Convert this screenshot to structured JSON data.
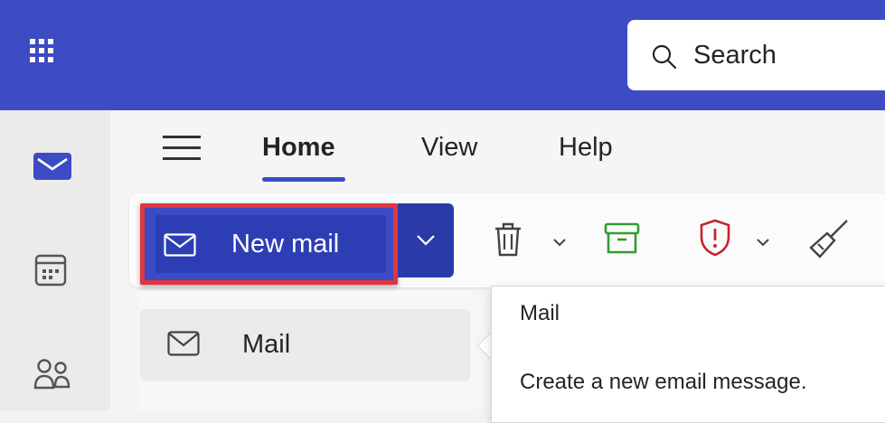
{
  "header": {
    "search_placeholder": "Search",
    "accent_color": "#3d4bc4"
  },
  "rail": {
    "items": [
      {
        "icon": "mail-icon",
        "active": true
      },
      {
        "icon": "calendar-icon",
        "active": false
      },
      {
        "icon": "people-icon",
        "active": false
      }
    ]
  },
  "tabs": [
    {
      "label": "Home",
      "active": true
    },
    {
      "label": "View",
      "active": false
    },
    {
      "label": "Help",
      "active": false
    }
  ],
  "ribbon": {
    "new_mail_label": "New mail",
    "new_mail_highlight_color": "#e03640",
    "tools": [
      "delete-icon",
      "archive-icon",
      "report-icon",
      "sweep-icon"
    ]
  },
  "dropdown": {
    "items": [
      {
        "label": "Mail",
        "icon": "mail-icon"
      }
    ]
  },
  "tooltip": {
    "title": "Mail",
    "description": "Create a new email message."
  }
}
